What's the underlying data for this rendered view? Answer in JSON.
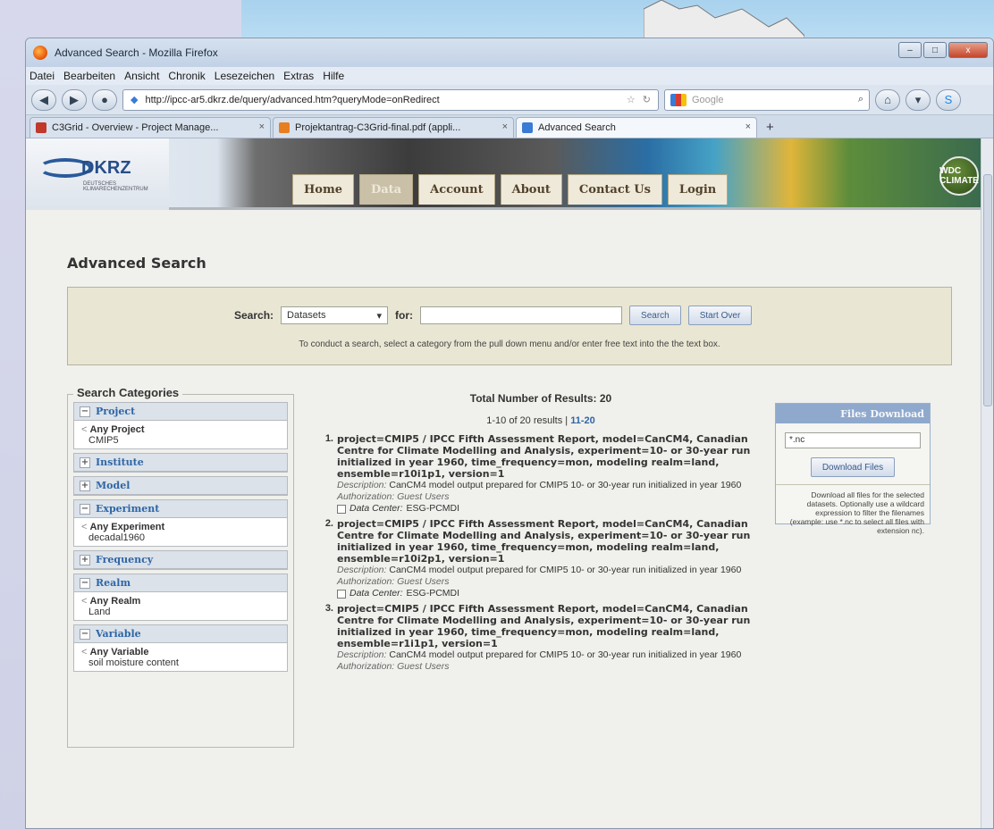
{
  "window": {
    "title": "Advanced Search - Mozilla Firefox",
    "controls": [
      "–",
      "□",
      "x"
    ]
  },
  "menubar": {
    "items": [
      "Datei",
      "Bearbeiten",
      "Ansicht",
      "Chronik",
      "Lesezeichen",
      "Extras",
      "Hilfe"
    ]
  },
  "navbar": {
    "url": "http://ipcc-ar5.dkrz.de/query/advanced.htm?queryMode=onRedirect",
    "search_placeholder": "Google"
  },
  "tabs": [
    {
      "label": "C3Grid - Overview - Project Manage...",
      "icon_color": "#c0392b"
    },
    {
      "label": "Projektantrag-C3Grid-final.pdf (appli...",
      "icon_color": "#e67e22"
    },
    {
      "label": "Advanced Search",
      "icon_color": "#3a7bd5"
    }
  ],
  "site": {
    "logo_text": "DKRZ",
    "logo_sub": "DEUTSCHES KLIMARECHENZENTRUM",
    "menu": [
      "Home",
      "Data",
      "Account",
      "About",
      "Contact Us",
      "Login"
    ],
    "selected_menu": "Data",
    "badge": "WDC CLIMATE"
  },
  "page": {
    "title": "Advanced Search",
    "search": {
      "label": "Search:",
      "category": "Datasets",
      "for_label": "for:",
      "search_button": "Search",
      "start_over_button": "Start Over",
      "hint": "To conduct a search, select a category from the pull down menu and/or enter free text into the the text box."
    },
    "categories": {
      "title": "Search Categories",
      "items": [
        {
          "name": "Project",
          "toggle": "−",
          "any": "Any Project",
          "value": "CMIP5"
        },
        {
          "name": "Institute",
          "toggle": "+"
        },
        {
          "name": "Model",
          "toggle": "+"
        },
        {
          "name": "Experiment",
          "toggle": "−",
          "any": "Any Experiment",
          "value": "decadal1960"
        },
        {
          "name": "Frequency",
          "toggle": "+"
        },
        {
          "name": "Realm",
          "toggle": "−",
          "any": "Any Realm",
          "value": "Land"
        },
        {
          "name": "Variable",
          "toggle": "−",
          "any": "Any Variable",
          "value": "soil moisture content"
        }
      ]
    },
    "results": {
      "total_label": "Total Number of Results: 20",
      "range": "1-10 of 20 results |",
      "next_range": "11-20",
      "items": [
        {
          "num": "1.",
          "title": "project=CMIP5 / IPCC Fifth Assessment Report, model=CanCM4, Canadian Centre for Climate Modelling and Analysis, experiment=10- or 30-year run initialized in year 1960, time_frequency=mon, modeling realm=land, ensemble=r10i1p1, version=1",
          "description_label": "Description:",
          "description": "CanCM4 model output prepared for CMIP5 10- or 30-year run initialized in year 1960",
          "authorization_label": "Authorization:",
          "authorization": "Guest Users",
          "data_center_label": "Data Center:",
          "data_center": "ESG-PCMDI"
        },
        {
          "num": "2.",
          "title": "project=CMIP5 / IPCC Fifth Assessment Report, model=CanCM4, Canadian Centre for Climate Modelling and Analysis, experiment=10- or 30-year run initialized in year 1960, time_frequency=mon, modeling realm=land, ensemble=r10i2p1, version=1",
          "description_label": "Description:",
          "description": "CanCM4 model output prepared for CMIP5 10- or 30-year run initialized in year 1960",
          "authorization_label": "Authorization:",
          "authorization": "Guest Users",
          "data_center_label": "Data Center:",
          "data_center": "ESG-PCMDI"
        },
        {
          "num": "3.",
          "title": "project=CMIP5 / IPCC Fifth Assessment Report, model=CanCM4, Canadian Centre for Climate Modelling and Analysis, experiment=10- or 30-year run initialized in year 1960, time_frequency=mon, modeling realm=land, ensemble=r1i1p1, version=1",
          "description_label": "Description:",
          "description": "CanCM4 model output prepared for CMIP5 10- or 30-year run initialized in year 1960",
          "authorization_label": "Authorization:",
          "authorization": "Guest Users"
        }
      ]
    },
    "files_download": {
      "title": "Files Download",
      "pattern": "*.nc",
      "button": "Download Files",
      "note": "Download all files for the selected datasets. Optionally use a wildcard expression to filter the filenames (example: use *.nc to select all files with extension nc)."
    }
  }
}
